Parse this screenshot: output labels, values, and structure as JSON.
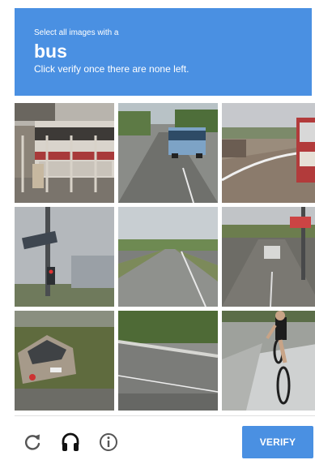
{
  "header": {
    "instruction": "Select all images with a",
    "target": "bus",
    "subtext": "Click verify once there are none left."
  },
  "grid": {
    "rows": 3,
    "columns": 3,
    "tiles": [
      {
        "scene": "bus parked behind fence"
      },
      {
        "scene": "city bus on road"
      },
      {
        "scene": "highway with bus at edge"
      },
      {
        "scene": "street sign and traffic light"
      },
      {
        "scene": "open highway"
      },
      {
        "scene": "road with car and sign"
      },
      {
        "scene": "parked car"
      },
      {
        "scene": "road with guardrail"
      },
      {
        "scene": "cyclist on road"
      }
    ]
  },
  "footer": {
    "icons": [
      "reload-icon",
      "headphones-icon",
      "info-icon"
    ],
    "verify_label": "VERIFY"
  },
  "colors": {
    "accent": "#4a90e2",
    "icon": "#555555",
    "divider": "#dfdfdf"
  }
}
